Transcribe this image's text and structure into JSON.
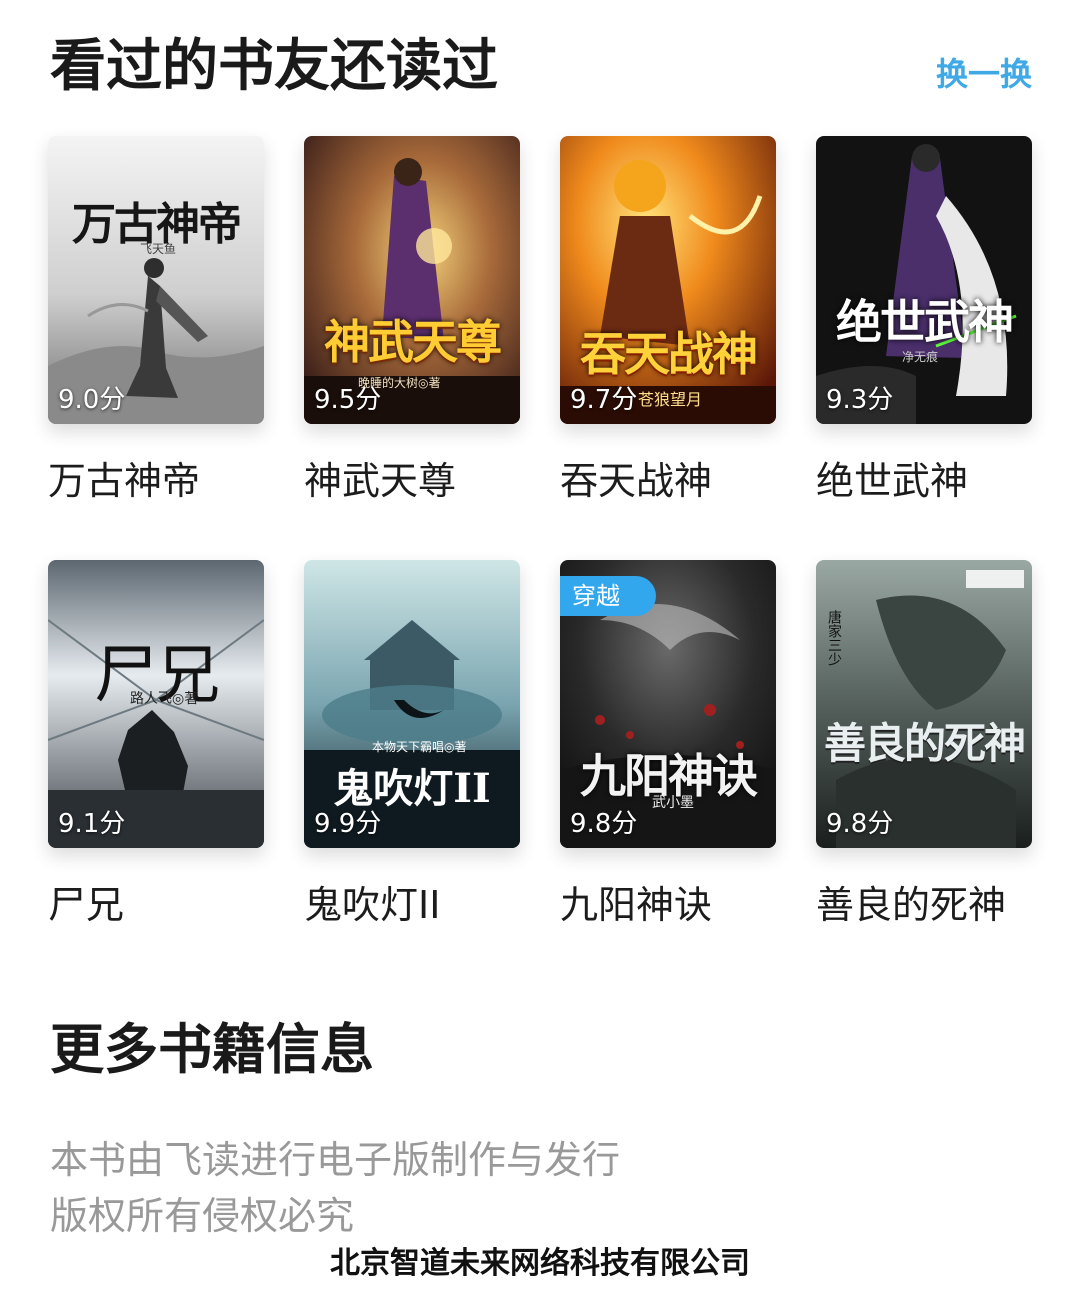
{
  "section": {
    "title": "看过的书友还读过",
    "refresh_label": "换一换"
  },
  "books": [
    {
      "name": "万古神帝",
      "score": "9.0分",
      "cover_title": "万古神帝",
      "cover_author": "飞天鱼"
    },
    {
      "name": "神武天尊",
      "score": "9.5分",
      "cover_title": "神武天尊",
      "cover_author": "晚睡的大树◎著"
    },
    {
      "name": "吞天战神",
      "score": "9.7分",
      "cover_title": "吞天战神",
      "cover_author": "苍狼望月"
    },
    {
      "name": "绝世武神",
      "score": "9.3分",
      "cover_title": "绝世武神",
      "cover_author": "净无痕"
    },
    {
      "name": "尸兄",
      "score": "9.1分",
      "cover_title": "尸兄",
      "cover_author": "路人飞◎著"
    },
    {
      "name": "鬼吹灯II",
      "score": "9.9分",
      "cover_title": "鬼吹灯ⅠⅠ",
      "cover_author": "本物天下霸唱◎著"
    },
    {
      "name": "九阳神诀",
      "score": "9.8分",
      "cover_title": "九阳神诀",
      "cover_author": "武小墨",
      "badge": "穿越"
    },
    {
      "name": "善良的死神",
      "score": "9.8分",
      "cover_title": "善良的死神",
      "cover_author": "唐家三少"
    }
  ],
  "more_info": {
    "title": "更多书籍信息",
    "line1": "本书由飞读进行电子版制作与发行",
    "line2": "版权所有侵权必究"
  },
  "company": "北京智道未来网络科技有限公司",
  "colors": {
    "accent": "#3fa9e6",
    "badge": "#32a7ee",
    "muted_text": "#999999"
  }
}
